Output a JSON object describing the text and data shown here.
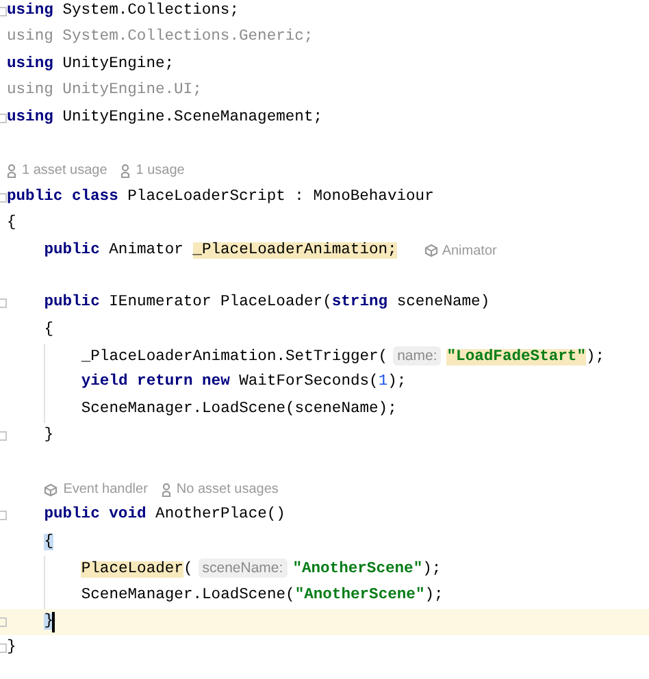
{
  "editor": {
    "lines": [
      {
        "kind": "code",
        "fold": true,
        "tokens": [
          {
            "kind": "keyword",
            "s": "using "
          },
          {
            "kind": "plain",
            "s": "System.Collections;"
          }
        ]
      },
      {
        "kind": "code",
        "tokens": [
          {
            "kind": "unused",
            "s": "using System.Collections.Generic;"
          }
        ]
      },
      {
        "kind": "code",
        "tokens": [
          {
            "kind": "keyword",
            "s": "using "
          },
          {
            "kind": "plain",
            "s": "UnityEngine;"
          }
        ]
      },
      {
        "kind": "code",
        "tokens": [
          {
            "kind": "unused",
            "s": "using UnityEngine.UI;"
          }
        ]
      },
      {
        "kind": "code",
        "fold": true,
        "tokens": [
          {
            "kind": "keyword",
            "s": "using "
          },
          {
            "kind": "plain",
            "s": "UnityEngine.SceneManagement;"
          }
        ]
      },
      {
        "kind": "blank"
      },
      {
        "kind": "hints",
        "items": [
          {
            "kind": "usage",
            "text": "1 asset usage"
          },
          {
            "kind": "usage",
            "text": "1 usage"
          }
        ]
      },
      {
        "kind": "code",
        "fold": true,
        "tokens": [
          {
            "kind": "keyword",
            "s": "public class "
          },
          {
            "kind": "plain",
            "s": "PlaceLoaderScript : MonoBehaviour"
          }
        ]
      },
      {
        "kind": "code",
        "tokens": [
          {
            "kind": "plain",
            "s": "{"
          }
        ],
        "children": [
          {
            "kind": "code",
            "tokens": [
              {
                "kind": "keyword",
                "s": "public "
              },
              {
                "kind": "plain",
                "s": "Animator "
              },
              {
                "kind": "plain",
                "s": "_PlaceLoaderAnimation;",
                "highlight": true
              }
            ],
            "inlay": {
              "kind": "event",
              "text": "Animator"
            }
          },
          {
            "kind": "blank"
          },
          {
            "kind": "code",
            "fold": true,
            "tokens": [
              {
                "kind": "keyword",
                "s": "public "
              },
              {
                "kind": "plain",
                "s": "IEnumerator PlaceLoader("
              },
              {
                "kind": "keyword",
                "s": "string "
              },
              {
                "kind": "plain",
                "s": "sceneName)"
              }
            ]
          },
          {
            "kind": "code",
            "tokens": [
              {
                "kind": "plain",
                "s": "{"
              }
            ],
            "children": [
              {
                "kind": "code",
                "tokens": [
                  {
                    "kind": "plain",
                    "s": "_PlaceLoaderAnimation.SetTrigger("
                  },
                  {
                    "kind": "param",
                    "s": "name:"
                  },
                  {
                    "kind": "string",
                    "s": "\"LoadFadeStart\"",
                    "highlight": true
                  },
                  {
                    "kind": "plain",
                    "s": ");"
                  }
                ]
              },
              {
                "kind": "code",
                "tokens": [
                  {
                    "kind": "keyword",
                    "s": "yield return new "
                  },
                  {
                    "kind": "plain",
                    "s": "WaitForSeconds("
                  },
                  {
                    "kind": "number",
                    "s": "1"
                  },
                  {
                    "kind": "plain",
                    "s": ");"
                  }
                ]
              },
              {
                "kind": "code",
                "tokens": [
                  {
                    "kind": "plain",
                    "s": "SceneManager.LoadScene(sceneName);"
                  }
                ]
              }
            ]
          },
          {
            "kind": "code",
            "fold": true,
            "tokens": [
              {
                "kind": "plain",
                "s": "}"
              }
            ]
          },
          {
            "kind": "blank"
          },
          {
            "kind": "hints",
            "items": [
              {
                "kind": "event",
                "text": "Event handler"
              },
              {
                "kind": "usage",
                "text": "No asset usages"
              }
            ]
          },
          {
            "kind": "code",
            "fold": true,
            "tokens": [
              {
                "kind": "keyword",
                "s": "public void "
              },
              {
                "kind": "plain",
                "s": "AnotherPlace()"
              }
            ]
          },
          {
            "kind": "code",
            "tokens": [
              {
                "kind": "plain",
                "s": "{",
                "matched": true
              }
            ],
            "children": [
              {
                "kind": "code",
                "tokens": [
                  {
                    "kind": "plain",
                    "s": "PlaceLoader",
                    "highlight": true
                  },
                  {
                    "kind": "plain",
                    "s": "("
                  },
                  {
                    "kind": "param",
                    "s": "sceneName:"
                  },
                  {
                    "kind": "string",
                    "s": "\"AnotherScene\""
                  },
                  {
                    "kind": "plain",
                    "s": ");"
                  }
                ]
              },
              {
                "kind": "code",
                "tokens": [
                  {
                    "kind": "plain",
                    "s": "SceneManager.LoadScene("
                  },
                  {
                    "kind": "string",
                    "s": "\"AnotherScene\""
                  },
                  {
                    "kind": "plain",
                    "s": ");"
                  }
                ]
              }
            ]
          },
          {
            "kind": "code",
            "fold": true,
            "current": true,
            "tokens": [
              {
                "kind": "plain",
                "s": "}",
                "matched": true
              }
            ]
          }
        ]
      },
      {
        "kind": "code",
        "fold": true,
        "tokens": [
          {
            "kind": "plain",
            "s": "}"
          }
        ]
      }
    ]
  }
}
